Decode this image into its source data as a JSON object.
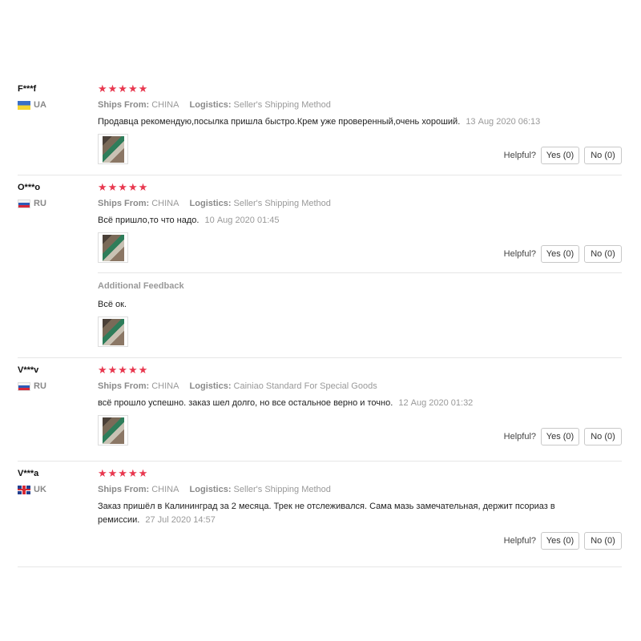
{
  "labels": {
    "ships_from": "Ships From:",
    "logistics": "Logistics:",
    "helpful": "Helpful?",
    "additional_feedback": "Additional Feedback"
  },
  "colors": {
    "stars": "#e8384f"
  },
  "reviews": [
    {
      "buyer": "F***f",
      "country": "UA",
      "flag_icon": "flag-ua",
      "stars": "★★★★★",
      "rating": 5,
      "ships_from": "CHINA",
      "logistics": "Seller's Shipping Method",
      "text": "Продавца рекомендую,посылка пришла быстро.Крем уже проверенный,очень хороший.",
      "date": "13 Aug 2020 06:13",
      "yes": "Yes (0)",
      "no": "No (0)"
    },
    {
      "buyer": "O***o",
      "country": "RU",
      "flag_icon": "flag-ru",
      "stars": "★★★★★",
      "rating": 5,
      "ships_from": "CHINA",
      "logistics": "Seller's Shipping Method",
      "text": "Всё пришло,то что надо.",
      "date": "10 Aug 2020 01:45",
      "yes": "Yes (0)",
      "no": "No (0)",
      "additional_text": "Всё ок."
    },
    {
      "buyer": "V***v",
      "country": "RU",
      "flag_icon": "flag-ru",
      "stars": "★★★★★",
      "rating": 5,
      "ships_from": "CHINA",
      "logistics": "Cainiao Standard For Special Goods",
      "text": "всё прошло успешно. заказ шел долго, но все остальное верно и точно.",
      "date": "12 Aug 2020 01:32",
      "yes": "Yes (0)",
      "no": "No (0)"
    },
    {
      "buyer": "V***a",
      "country": "UK",
      "flag_icon": "flag-uk",
      "stars": "★★★★★",
      "rating": 5,
      "ships_from": "CHINA",
      "logistics": "Seller's Shipping Method",
      "text": "Заказ пришёл в Калининград за 2 месяца. Трек не отслеживался. Сама мазь замечательная, держит псориаз в ремиссии.",
      "date": "27 Jul 2020 14:57",
      "yes": "Yes (0)",
      "no": "No (0)"
    }
  ]
}
